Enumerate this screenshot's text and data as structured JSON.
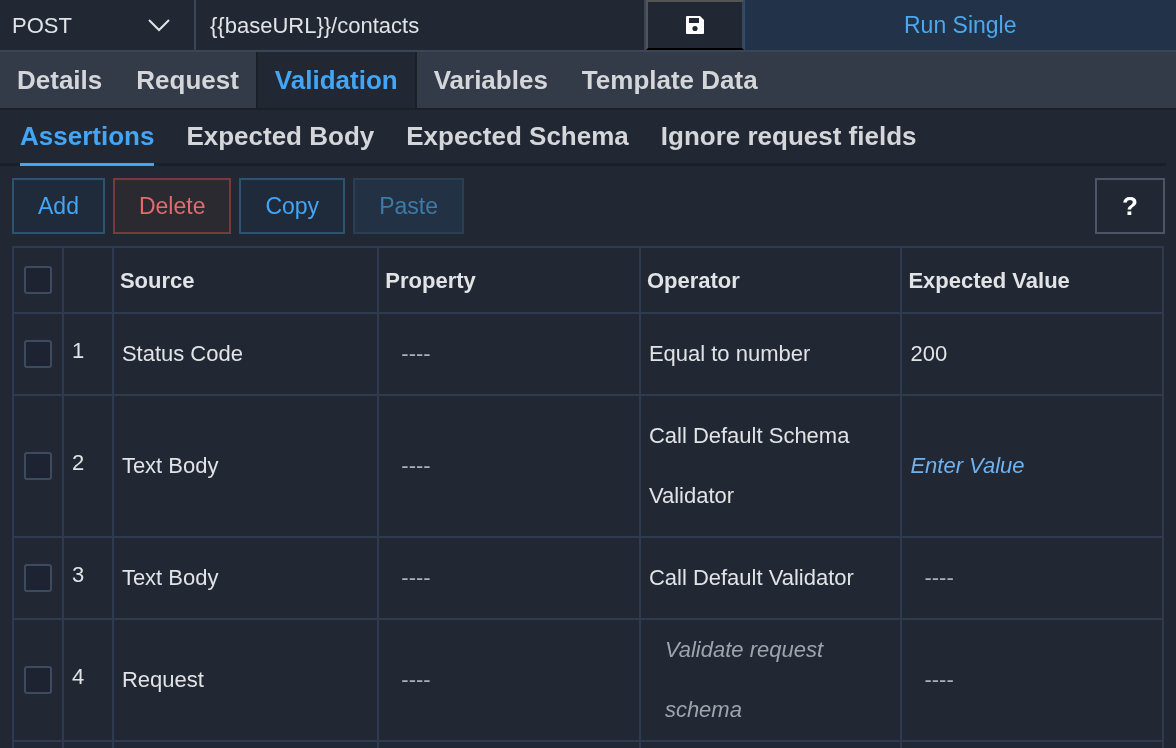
{
  "request_bar": {
    "method": "POST",
    "url": "{{baseURL}}/contacts",
    "run_button": "Run Single"
  },
  "tabs": [
    {
      "label": "Details",
      "selected": false
    },
    {
      "label": "Request",
      "selected": false
    },
    {
      "label": "Validation",
      "selected": true
    },
    {
      "label": "Variables",
      "selected": false
    },
    {
      "label": "Template Data",
      "selected": false
    }
  ],
  "subtabs": [
    {
      "label": "Assertions",
      "selected": true
    },
    {
      "label": "Expected Body",
      "selected": false
    },
    {
      "label": "Expected Schema",
      "selected": false
    },
    {
      "label": "Ignore request fields",
      "selected": false
    }
  ],
  "toolbar": [
    {
      "label": "Add",
      "kind": "primary",
      "disabled": false
    },
    {
      "label": "Delete",
      "kind": "danger",
      "disabled": false
    },
    {
      "label": "Copy",
      "kind": "primary",
      "disabled": false
    },
    {
      "label": "Paste",
      "kind": "primary",
      "disabled": true
    }
  ],
  "help_button": "?",
  "table": {
    "select_all_checked": false,
    "columns": [
      "Source",
      "Property",
      "Operator",
      "Expected Value"
    ],
    "rows": [
      {
        "checked": false,
        "number": "1",
        "cells": [
          {
            "kind": "text",
            "text": "Status Code"
          },
          {
            "kind": "dash",
            "text": "----"
          },
          {
            "kind": "text",
            "text": "Equal to number"
          },
          {
            "kind": "text",
            "text": "200"
          }
        ]
      },
      {
        "checked": false,
        "number": "2",
        "cells": [
          {
            "kind": "text",
            "text": "Text Body"
          },
          {
            "kind": "dash",
            "text": "----"
          },
          {
            "kind": "text",
            "text": "Call Default Schema Validator"
          },
          {
            "kind": "link",
            "text": "Enter Value"
          }
        ]
      },
      {
        "checked": false,
        "number": "3",
        "cells": [
          {
            "kind": "text",
            "text": "Text Body"
          },
          {
            "kind": "dash",
            "text": "----"
          },
          {
            "kind": "text",
            "text": "Call Default Validator"
          },
          {
            "kind": "dash",
            "text": "----"
          }
        ]
      },
      {
        "checked": false,
        "number": "4",
        "cells": [
          {
            "kind": "text",
            "text": "Request"
          },
          {
            "kind": "dash",
            "text": "----"
          },
          {
            "kind": "hint",
            "text": "Validate request schema"
          },
          {
            "kind": "dash",
            "text": "----"
          }
        ]
      }
    ]
  }
}
